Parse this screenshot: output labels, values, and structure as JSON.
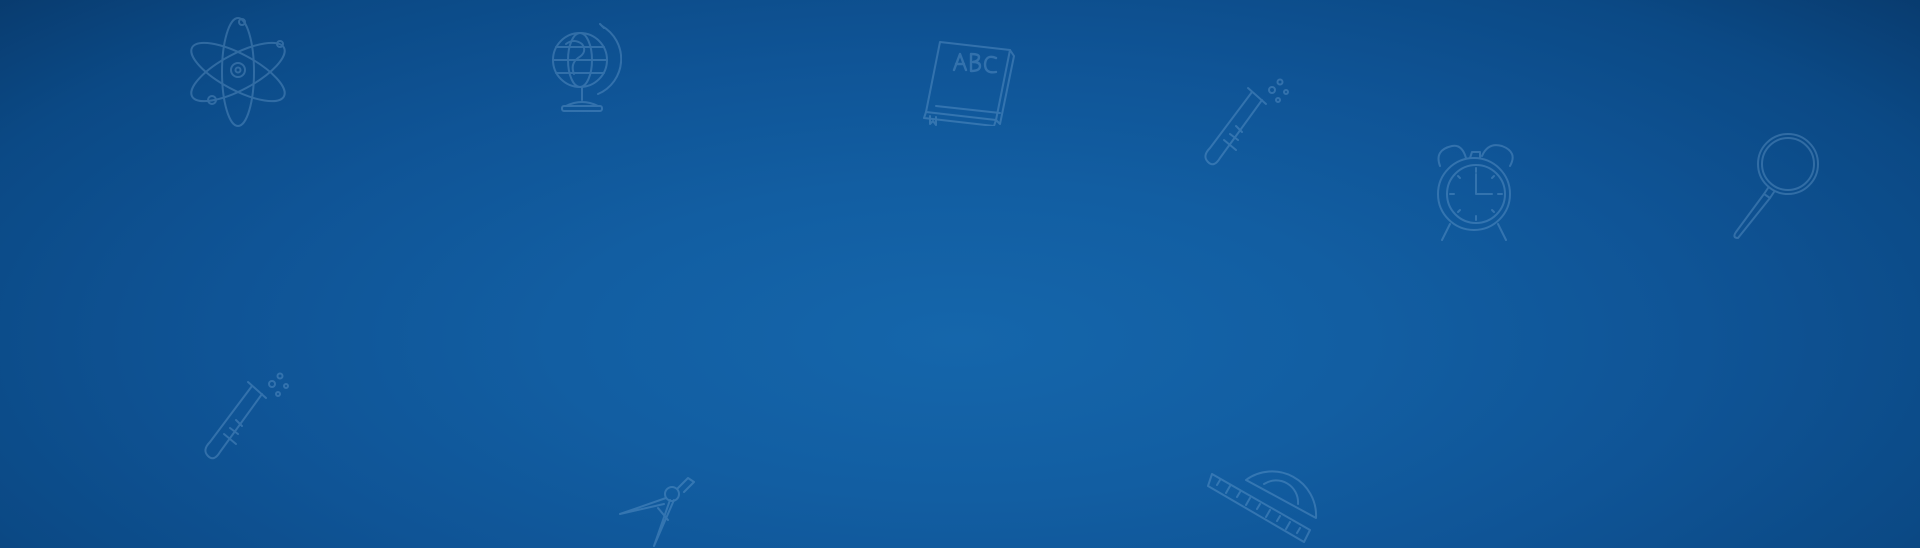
{
  "theme": {
    "background_center": "#1566ab",
    "background_edge": "#08396b",
    "doodle_color": "#7fb0dc"
  },
  "doodles": [
    {
      "id": "atom",
      "icon": "atom-icon"
    },
    {
      "id": "globe",
      "icon": "globe-icon"
    },
    {
      "id": "book",
      "icon": "abc-book-icon",
      "label": "ABC"
    },
    {
      "id": "tube1",
      "icon": "test-tube-icon"
    },
    {
      "id": "clock",
      "icon": "alarm-clock-icon"
    },
    {
      "id": "magnifier",
      "icon": "magnifying-glass-icon"
    },
    {
      "id": "tube2",
      "icon": "test-tube-icon"
    },
    {
      "id": "compass",
      "icon": "drawing-compass-icon"
    },
    {
      "id": "protractor",
      "icon": "protractor-icon"
    }
  ]
}
